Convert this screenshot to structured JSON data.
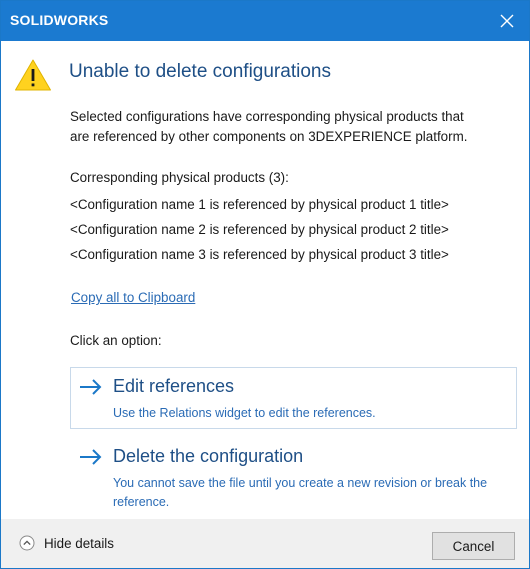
{
  "window": {
    "title": "SOLIDWORKS"
  },
  "dialog": {
    "heading": "Unable to delete configurations",
    "message_line1": "Selected configurations have corresponding physical products that",
    "message_line2": "are referenced by other components on 3DEXPERIENCE platform.",
    "products_header": "Corresponding physical products (3):",
    "products": [
      "<Configuration name 1 is referenced by physical product 1 title>",
      "<Configuration name 2 is referenced by physical product 2 title>",
      "<Configuration name 3 is referenced by physical product 3 title>"
    ],
    "copy_link": "Copy all to Clipboard",
    "options_label": "Click an option:",
    "options": [
      {
        "title": "Edit references",
        "description": "Use the Relations widget to edit the references."
      },
      {
        "title": "Delete the configuration",
        "description": "You cannot save the file until you create a new revision or break the reference."
      }
    ]
  },
  "footer": {
    "hide_details": "Hide details",
    "cancel": "Cancel"
  },
  "icons": {
    "warning": "warning-icon",
    "close": "close-icon",
    "arrow": "arrow-right-icon",
    "collapse": "chevron-up-circle-icon"
  },
  "colors": {
    "titlebar": "#1b7ad0",
    "heading": "#1e4f86",
    "link": "#2a6bb5",
    "warning": "#ffd21f"
  }
}
